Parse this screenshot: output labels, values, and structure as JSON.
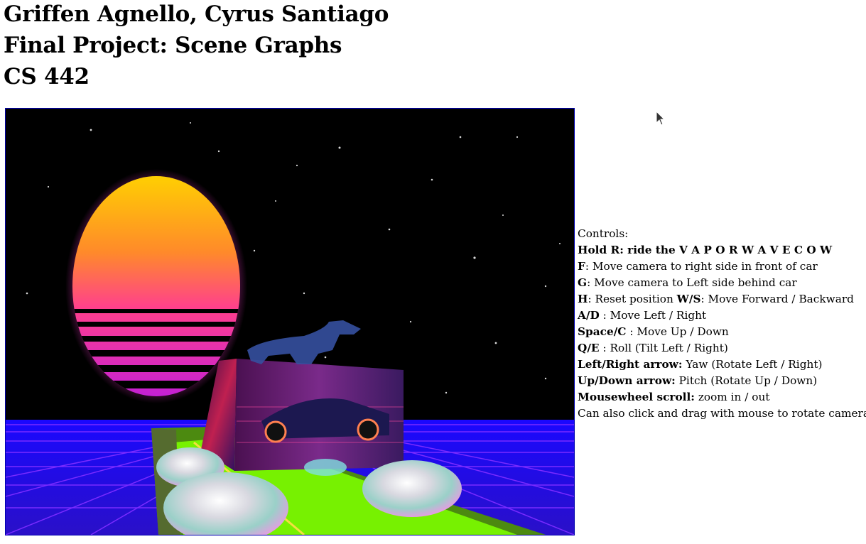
{
  "header": {
    "authors": "Griffen Agnello, Cyrus Santiago",
    "project": "Final Project: Scene Graphs",
    "course": "CS 442"
  },
  "controls": {
    "heading": "Controls:",
    "lines": [
      {
        "key": "Hold R: ride the V A P O R W A V E C O W",
        "desc": ""
      },
      {
        "key": "F",
        "desc": ": Move camera to right side in front of car"
      },
      {
        "key": "G",
        "desc": ": Move camera to Left side behind car"
      },
      {
        "key": "H",
        "desc": ": Reset position ",
        "key2": "W/S",
        "desc2": ": Move Forward / Backward"
      },
      {
        "key": "A/D",
        "desc": " : Move Left / Right"
      },
      {
        "key": "Space/C",
        "desc": " : Move Up / Down"
      },
      {
        "key": "Q/E",
        "desc": " : Roll (Tilt Left / Right)"
      },
      {
        "key": "Left/Right arrow:",
        "desc": " Yaw (Rotate Left / Right)"
      },
      {
        "key": "Up/Down arrow:",
        "desc": " Pitch (Rotate Up / Down)"
      },
      {
        "key": "Mousewheel scroll:",
        "desc": " zoom in / out"
      },
      {
        "key": "",
        "desc": "Can also click and drag with mouse to rotate camera"
      }
    ]
  },
  "colors": {
    "canvas_border": "#0000b0",
    "grid": "#8a2be2",
    "road": "#7cfc00"
  }
}
